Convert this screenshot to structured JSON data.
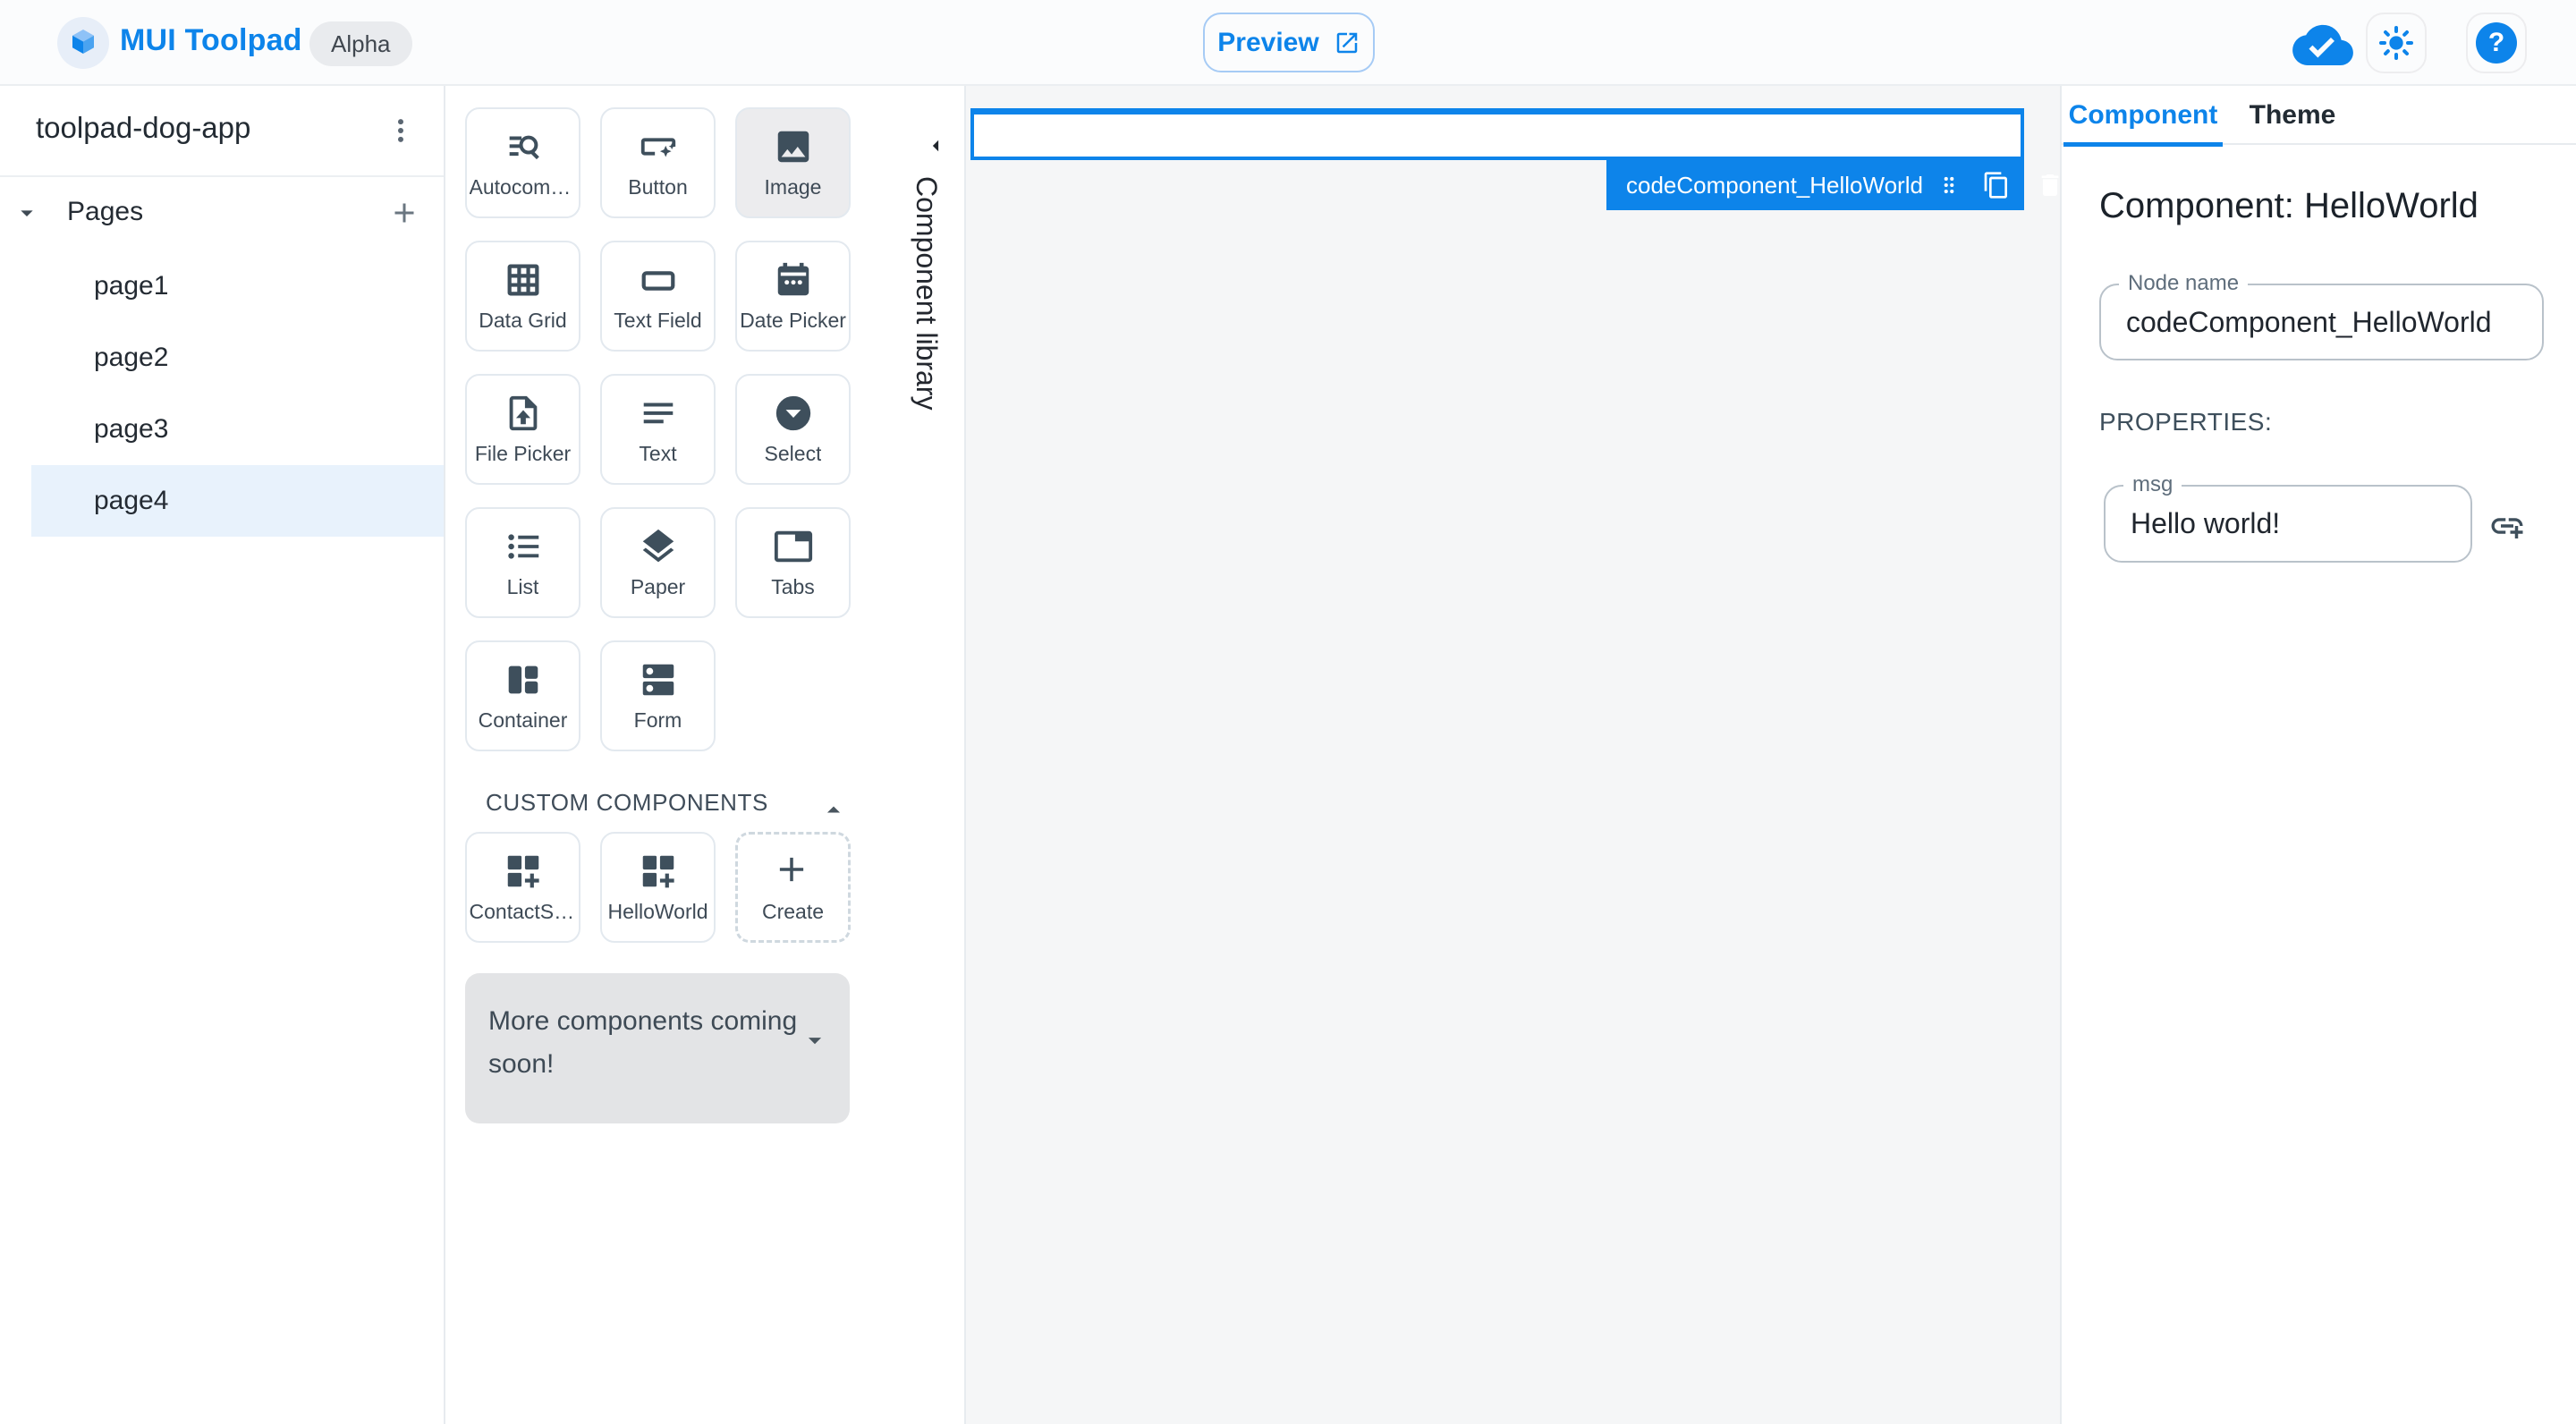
{
  "colors": {
    "primary": "#0d84ea",
    "slate": "#3e4f5c",
    "canvas-bg": "#f5f6f7",
    "highlight": "#e8f2fc",
    "chip-bg": "#e9ebee",
    "more-bg": "#e3e4e6"
  },
  "app_bar": {
    "brand": "MUI Toolpad",
    "badge": "Alpha",
    "preview_label": "Preview"
  },
  "sidebar": {
    "project_name": "toolpad-dog-app",
    "pages_label": "Pages",
    "pages": [
      "page1",
      "page2",
      "page3",
      "page4"
    ],
    "selected_page": "page4"
  },
  "library": {
    "section_title": "Component library",
    "components": [
      "Autocomplete",
      "Button",
      "Image",
      "Data Grid",
      "Text Field",
      "Date Picker",
      "File Picker",
      "Text",
      "Select",
      "List",
      "Paper",
      "Tabs",
      "Container",
      "Form"
    ],
    "selected_component": "Image",
    "custom_header": "CUSTOM COMPONENTS",
    "custom": [
      "ContactSta…",
      "HelloWorld"
    ],
    "create_label": "Create",
    "coming_soon": "More components coming soon!"
  },
  "canvas": {
    "selection_label": "codeComponent_HelloWorld"
  },
  "inspector": {
    "tab_component": "Component",
    "tab_theme": "Theme",
    "title": "Component: HelloWorld",
    "node_name_label": "Node name",
    "node_name_value": "codeComponent_HelloWorld",
    "properties_heading": "PROPERTIES:",
    "msg_label": "msg",
    "msg_value": "Hello world!"
  }
}
